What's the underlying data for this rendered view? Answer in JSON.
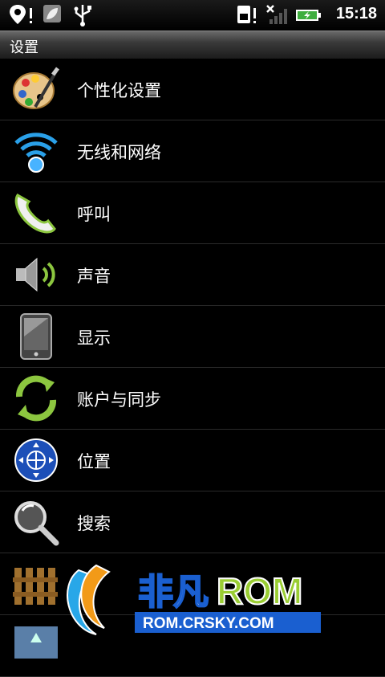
{
  "status": {
    "time": "15:18"
  },
  "title": "设置",
  "items": [
    {
      "label": "个性化设置",
      "icon": "palette-icon"
    },
    {
      "label": "无线和网络",
      "icon": "wifi-icon"
    },
    {
      "label": "呼叫",
      "icon": "phone-icon"
    },
    {
      "label": "声音",
      "icon": "speaker-icon"
    },
    {
      "label": "显示",
      "icon": "display-icon"
    },
    {
      "label": "账户与同步",
      "icon": "sync-icon"
    },
    {
      "label": "位置",
      "icon": "location-icon"
    },
    {
      "label": "搜索",
      "icon": "search-icon"
    },
    {
      "label": "",
      "icon": "fence-icon"
    },
    {
      "label": "",
      "icon": "partial-icon"
    }
  ],
  "watermark": {
    "brand": "非凡ROM",
    "url": "ROM.CRSKY.COM"
  }
}
